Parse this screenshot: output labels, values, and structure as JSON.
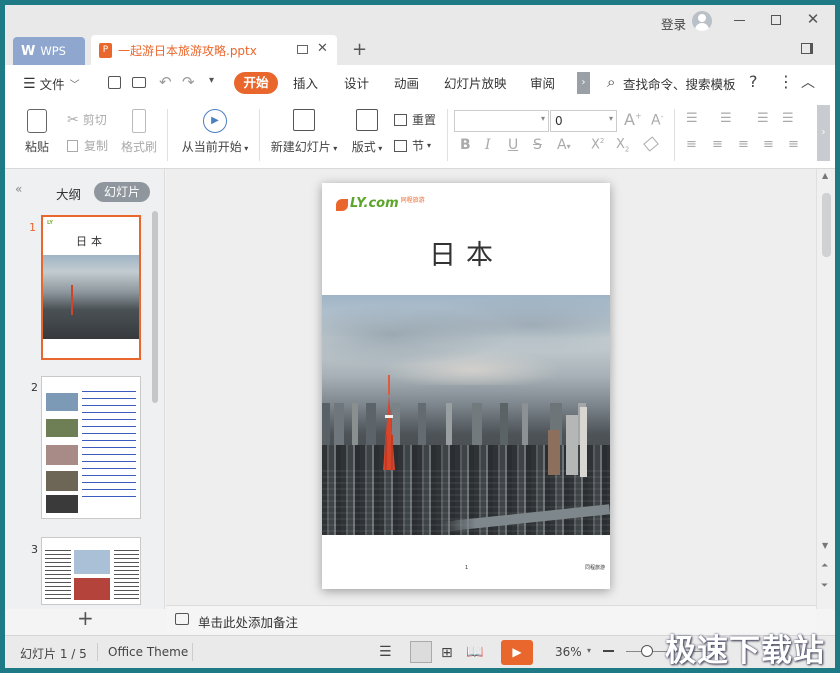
{
  "window": {
    "login_label": "登录",
    "wps_tab_label": "WPS",
    "doc_tab_label": "一起游日本旅游攻略.pptx"
  },
  "menu": {
    "file_label": "文件",
    "items": [
      "开始",
      "插入",
      "设计",
      "动画",
      "幻灯片放映",
      "审阅"
    ],
    "active_item": "开始",
    "search_label": "查找命令、搜索模板",
    "accent_color": "#e9672c"
  },
  "ribbon": {
    "paste_label": "粘贴",
    "cut_label": "剪切",
    "copy_label": "复制",
    "format_painter_label": "格式刷",
    "from_current_label": "从当前开始",
    "new_slide_label": "新建幻灯片",
    "layout_label": "版式",
    "reset_label": "重置",
    "section_label": "节",
    "font_name_value": "",
    "font_size_value": "0"
  },
  "left_panel": {
    "outline_tab": "大纲",
    "slides_tab": "幻灯片",
    "thumbnails": [
      {
        "number": "1",
        "title": "日本",
        "selected": true
      },
      {
        "number": "2",
        "selected": false
      },
      {
        "number": "3",
        "selected": false
      }
    ]
  },
  "slide": {
    "logo_text": "LY.com",
    "logo_sub": "同程旅游",
    "title": "日本",
    "page_marker": "1",
    "footer_logo": "同程旅游"
  },
  "notes": {
    "placeholder": "单击此处添加备注"
  },
  "status": {
    "slide_counter": "幻灯片 1 / 5",
    "theme_name": "Office Theme",
    "zoom_value": "36%",
    "zoom_level": 0.36
  },
  "watermark": {
    "text": "极速下载站"
  }
}
